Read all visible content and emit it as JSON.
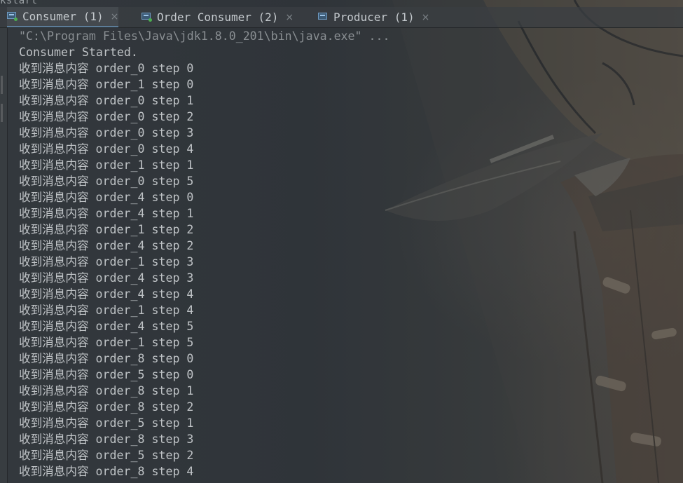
{
  "top_overflow_text": "kstart",
  "tabs": [
    {
      "label": "Consumer (1)",
      "close": "×"
    },
    {
      "label": "Order Consumer (2)",
      "close": "×"
    },
    {
      "label": "Producer (1)",
      "close": "×"
    }
  ],
  "console": {
    "command_line": "\"C:\\Program Files\\Java\\jdk1.8.0_201\\bin\\java.exe\" ...",
    "started_line": "Consumer Started.",
    "messages": [
      "收到消息内容 order_0 step 0",
      "收到消息内容 order_1 step 0",
      "收到消息内容 order_0 step 1",
      "收到消息内容 order_0 step 2",
      "收到消息内容 order_0 step 3",
      "收到消息内容 order_0 step 4",
      "收到消息内容 order_1 step 1",
      "收到消息内容 order_0 step 5",
      "收到消息内容 order_4 step 0",
      "收到消息内容 order_4 step 1",
      "收到消息内容 order_1 step 2",
      "收到消息内容 order_4 step 2",
      "收到消息内容 order_1 step 3",
      "收到消息内容 order_4 step 3",
      "收到消息内容 order_4 step 4",
      "收到消息内容 order_1 step 4",
      "收到消息内容 order_4 step 5",
      "收到消息内容 order_1 step 5",
      "收到消息内容 order_8 step 0",
      "收到消息内容 order_5 step 0",
      "收到消息内容 order_8 step 1",
      "收到消息内容 order_8 step 2",
      "收到消息内容 order_5 step 1",
      "收到消息内容 order_8 step 3",
      "收到消息内容 order_5 step 2",
      "收到消息内容 order_8 step 4"
    ]
  },
  "colors": {
    "console_text": "#bfc3c6",
    "command_text": "#8a8f93",
    "tab_text": "#c4c9cd",
    "tab_icon": "#6f9ac1",
    "running_dot": "#4caf50"
  },
  "icons": {
    "tab_icon": "console-window-icon",
    "running_indicator": "running-dot-icon",
    "close": "close-icon"
  }
}
